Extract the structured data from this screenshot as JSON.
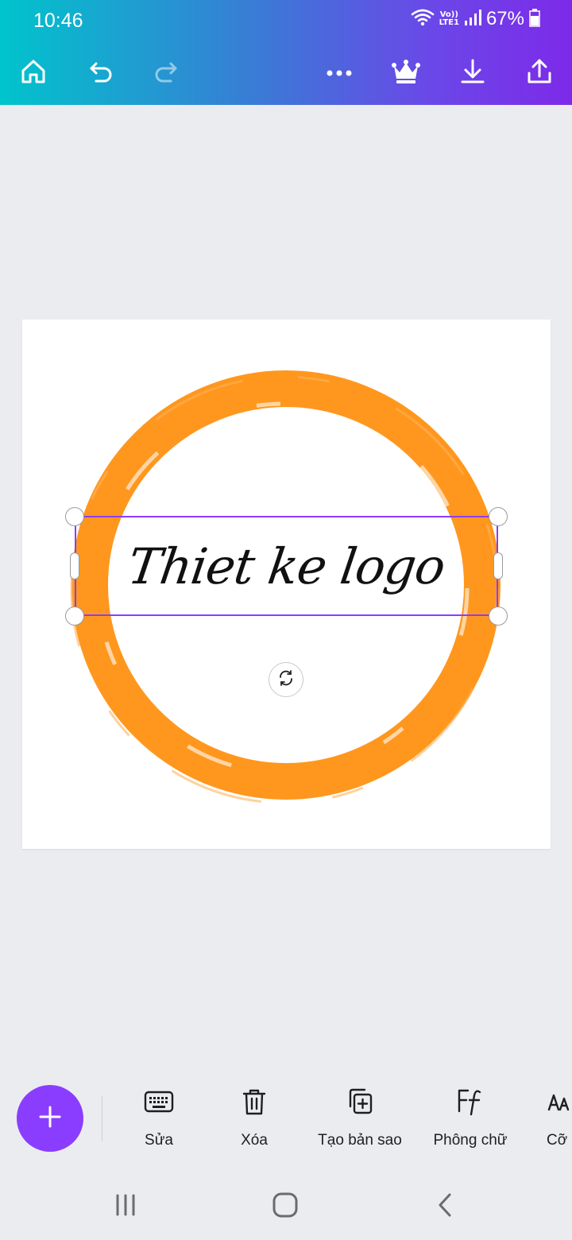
{
  "status_bar": {
    "time": "10:46",
    "lte_top": "Vo))",
    "lte_bottom": "LTE1",
    "battery": "67%"
  },
  "toolbar": {
    "icons": [
      "home-icon",
      "undo-icon",
      "redo-icon",
      "more-icon",
      "crown-icon",
      "download-icon",
      "share-icon"
    ]
  },
  "canvas": {
    "text": "Thiet ke logo",
    "ring_color": "#ff971e",
    "selection_color": "#8b3dff"
  },
  "actions": [
    {
      "label": "Sửa",
      "icon": "keyboard-icon"
    },
    {
      "label": "Xóa",
      "icon": "trash-icon"
    },
    {
      "label": "Tạo bản sao",
      "icon": "duplicate-icon"
    },
    {
      "label": "Phông chữ",
      "icon": "font-icon"
    },
    {
      "label": "Cỡ c",
      "icon": "font-size-icon"
    }
  ],
  "fab": {
    "icon": "plus-icon",
    "color": "#8b3dff"
  },
  "navbar": {
    "icons": [
      "recent-apps-icon",
      "home-nav-icon",
      "back-icon"
    ]
  }
}
